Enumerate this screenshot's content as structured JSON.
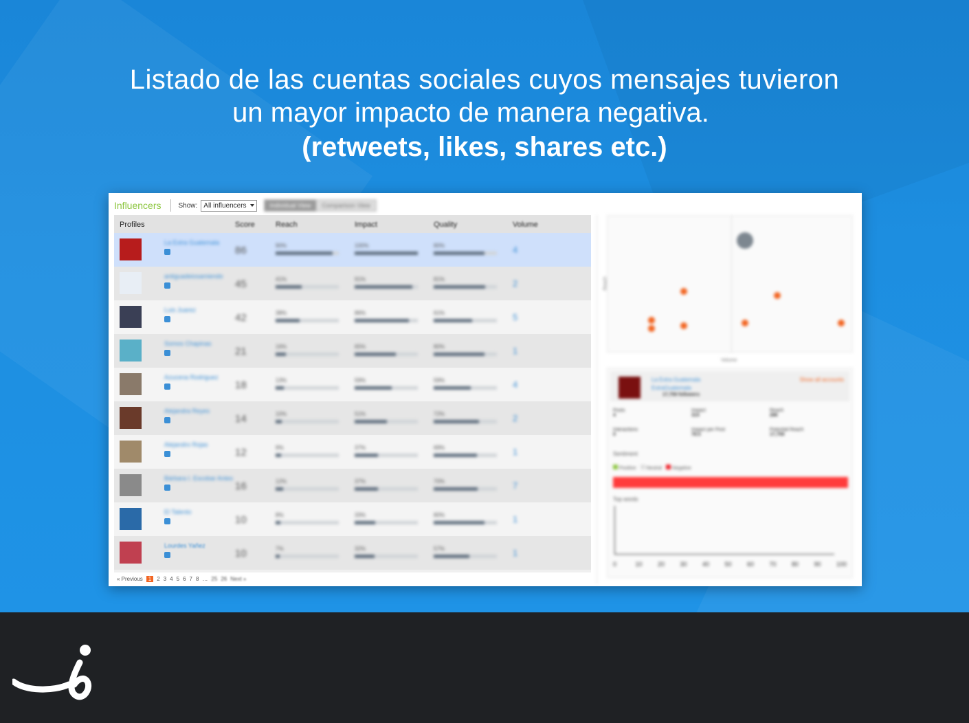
{
  "headline": {
    "line1": "Listado de las cuentas sociales cuyos mensajes tuvieron",
    "line2": "un mayor impacto de manera negativa.",
    "line3": "(retweets, likes, shares etc.)"
  },
  "toolbar": {
    "title": "Influencers",
    "show_label": "Show:",
    "show_value": "All influencers",
    "view_individual": "Individual View",
    "view_comparison": "Comparison View"
  },
  "table": {
    "headers": {
      "profiles": "Profiles",
      "score": "Score",
      "reach": "Reach",
      "impact": "Impact",
      "quality": "Quality",
      "volume": "Volume"
    },
    "rows": [
      {
        "name": "La Extra Guatemala",
        "score": "86",
        "reach": "90%",
        "impact": "100%",
        "quality": "80%",
        "volume": "4",
        "reach_v": 0.9,
        "impact_v": 1.0,
        "quality_v": 0.8,
        "avatar_color": "#b71c1c"
      },
      {
        "name": "antiguadeiosamiendo",
        "score": "45",
        "reach": "41%",
        "impact": "91%",
        "quality": "81%",
        "volume": "2",
        "reach_v": 0.41,
        "impact_v": 0.91,
        "quality_v": 0.81,
        "avatar_color": "#e8eef5"
      },
      {
        "name": "Luis Juarez",
        "score": "42",
        "reach": "38%",
        "impact": "86%",
        "quality": "61%",
        "volume": "5",
        "reach_v": 0.38,
        "impact_v": 0.86,
        "quality_v": 0.61,
        "avatar_color": "#3a3f55"
      },
      {
        "name": "Somos Chapinas",
        "score": "21",
        "reach": "16%",
        "impact": "65%",
        "quality": "80%",
        "volume": "1",
        "reach_v": 0.16,
        "impact_v": 0.65,
        "quality_v": 0.8,
        "avatar_color": "#5ab0c8"
      },
      {
        "name": "Azucena Rodriguez",
        "score": "18",
        "reach": "13%",
        "impact": "59%",
        "quality": "59%",
        "volume": "4",
        "reach_v": 0.13,
        "impact_v": 0.59,
        "quality_v": 0.59,
        "avatar_color": "#8a7a6a"
      },
      {
        "name": "Alejandra Reyes",
        "score": "14",
        "reach": "10%",
        "impact": "51%",
        "quality": "72%",
        "volume": "2",
        "reach_v": 0.1,
        "impact_v": 0.51,
        "quality_v": 0.72,
        "avatar_color": "#6a3a2a"
      },
      {
        "name": "Alejandro Rojas",
        "score": "12",
        "reach": "9%",
        "impact": "37%",
        "quality": "69%",
        "volume": "1",
        "reach_v": 0.09,
        "impact_v": 0.37,
        "quality_v": 0.69,
        "avatar_color": "#a08a6a"
      },
      {
        "name": "Bárbara I. Escobar Antes",
        "score": "16",
        "reach": "12%",
        "impact": "37%",
        "quality": "70%",
        "volume": "7",
        "reach_v": 0.12,
        "impact_v": 0.37,
        "quality_v": 0.7,
        "avatar_color": "#8a8a8a"
      },
      {
        "name": "El Talento",
        "score": "10",
        "reach": "8%",
        "impact": "33%",
        "quality": "80%",
        "volume": "1",
        "reach_v": 0.08,
        "impact_v": 0.33,
        "quality_v": 0.8,
        "avatar_color": "#2a6aa8"
      },
      {
        "name": "Lourdes Yañez",
        "score": "10",
        "reach": "7%",
        "impact": "32%",
        "quality": "57%",
        "volume": "1",
        "reach_v": 0.07,
        "impact_v": 0.32,
        "quality_v": 0.57,
        "avatar_color": "#c04050"
      }
    ]
  },
  "pager": {
    "prev": "« Previous",
    "pages": [
      "1",
      "2",
      "3",
      "4",
      "5",
      "6",
      "7",
      "8",
      "…",
      "25",
      "26"
    ],
    "next": "Next »"
  },
  "scatter": {
    "xlabel": "Volume",
    "ylabel": "Reach",
    "points": [
      {
        "x": 0.56,
        "y": 0.82,
        "big": true
      },
      {
        "x": 0.31,
        "y": 0.45
      },
      {
        "x": 0.69,
        "y": 0.42
      },
      {
        "x": 0.18,
        "y": 0.24
      },
      {
        "x": 0.18,
        "y": 0.18
      },
      {
        "x": 0.31,
        "y": 0.2
      },
      {
        "x": 0.56,
        "y": 0.22
      },
      {
        "x": 0.95,
        "y": 0.22
      }
    ]
  },
  "detail": {
    "name": "La Extra Guatemala",
    "handle": "ExtraGuatemala",
    "followers": "17,759 followers",
    "link": "Show all accounts",
    "stats": [
      {
        "label": "Posts",
        "value": "4"
      },
      {
        "label": "Impact",
        "value": "314"
      },
      {
        "label": "Reach",
        "value": "286"
      },
      {
        "label": "Interactions",
        "value": "0"
      },
      {
        "label": "Impact per Post",
        "value": "78.5"
      },
      {
        "label": "Potential Reach",
        "value": "17,759"
      }
    ],
    "sentiment_label": "Sentiment",
    "legend": [
      "Positive",
      "Neutral",
      "Negative"
    ],
    "colors": {
      "positive": "#8cc63f",
      "neutral": "#dddddd",
      "negative": "#ee1c25"
    },
    "top_words": "Top words",
    "axis_ticks": [
      "0",
      "10",
      "20",
      "30",
      "40",
      "50",
      "60",
      "70",
      "80",
      "90",
      "100"
    ]
  }
}
